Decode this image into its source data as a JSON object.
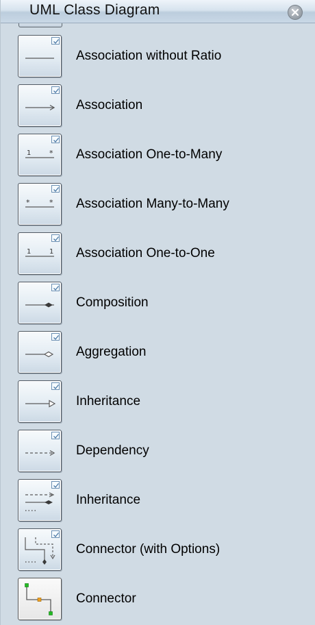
{
  "panel": {
    "title": "UML Class Diagram",
    "close_icon": "close-icon"
  },
  "items": [
    {
      "label": "Association without Ratio",
      "icon": "association-without-ratio-icon"
    },
    {
      "label": "Association",
      "icon": "association-arrow-icon"
    },
    {
      "label": "Association One-to-Many",
      "icon": "association-one-to-many-icon"
    },
    {
      "label": "Association Many-to-Many",
      "icon": "association-many-to-many-icon"
    },
    {
      "label": "Association One-to-One",
      "icon": "association-one-to-one-icon"
    },
    {
      "label": "Composition",
      "icon": "composition-icon"
    },
    {
      "label": "Aggregation",
      "icon": "aggregation-icon"
    },
    {
      "label": "Inheritance",
      "icon": "inheritance-icon"
    },
    {
      "label": "Dependency",
      "icon": "dependency-icon"
    },
    {
      "label": "Inheritance",
      "icon": "inheritance-dashed-icon"
    },
    {
      "label": "Connector (with Options)",
      "icon": "connector-with-options-icon"
    },
    {
      "label": "Connector",
      "icon": "connector-icon"
    }
  ],
  "icon_glyphs": {
    "one": "1",
    "many": "*"
  },
  "colors": {
    "panel_bg": "#d0dbe4",
    "line": "#5a5a5a",
    "connector_end": "#22bb22",
    "connector_mid": "#f0a020"
  }
}
